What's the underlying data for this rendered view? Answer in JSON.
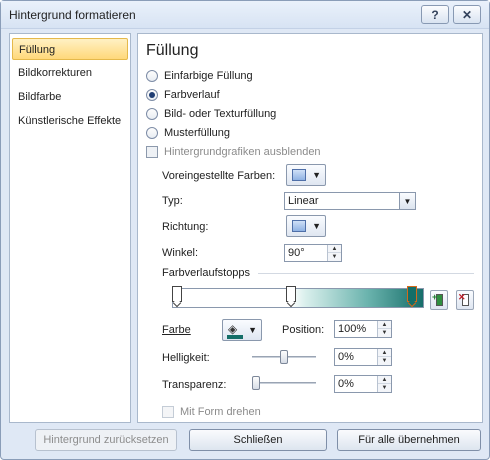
{
  "window": {
    "title": "Hintergrund formatieren",
    "help_label": "?",
    "close_label": "✕"
  },
  "sidebar": {
    "items": [
      {
        "label": "Füllung"
      },
      {
        "label": "Bildkorrekturen"
      },
      {
        "label": "Bildfarbe"
      },
      {
        "label": "Künstlerische Effekte"
      }
    ],
    "active_index": 0
  },
  "panel": {
    "heading": "Füllung",
    "fill_options": [
      {
        "label": "Einfarbige Füllung",
        "selected": false
      },
      {
        "label": "Farbverlauf",
        "selected": true
      },
      {
        "label": "Bild- oder Texturfüllung",
        "selected": false
      },
      {
        "label": "Musterfüllung",
        "selected": false
      }
    ],
    "hide_background_graphics": {
      "label": "Hintergrundgrafiken ausblenden",
      "checked": false
    },
    "preset_colors": {
      "label": "Voreingestellte Farben:"
    },
    "type": {
      "label": "Typ:",
      "value": "Linear"
    },
    "direction": {
      "label": "Richtung:"
    },
    "angle": {
      "label": "Winkel:",
      "value": "90°"
    },
    "gradient_stops": {
      "label": "Farbverlaufstopps",
      "stops": [
        0,
        0.47,
        0.97
      ],
      "selected_stop": 2,
      "stop_color": "#146e68"
    },
    "color": {
      "label": "Farbe"
    },
    "position": {
      "label": "Position:",
      "value": "100%"
    },
    "brightness": {
      "label": "Helligkeit:",
      "value": "0%",
      "level": 0.5
    },
    "transparency": {
      "label": "Transparenz:",
      "value": "0%",
      "level": 0
    },
    "rotate_with_shape": {
      "label": "Mit Form drehen",
      "checked": false
    }
  },
  "footer": {
    "reset_label": "Hintergrund zurücksetzen",
    "close_label": "Schließen",
    "apply_all_label": "Für alle übernehmen"
  }
}
